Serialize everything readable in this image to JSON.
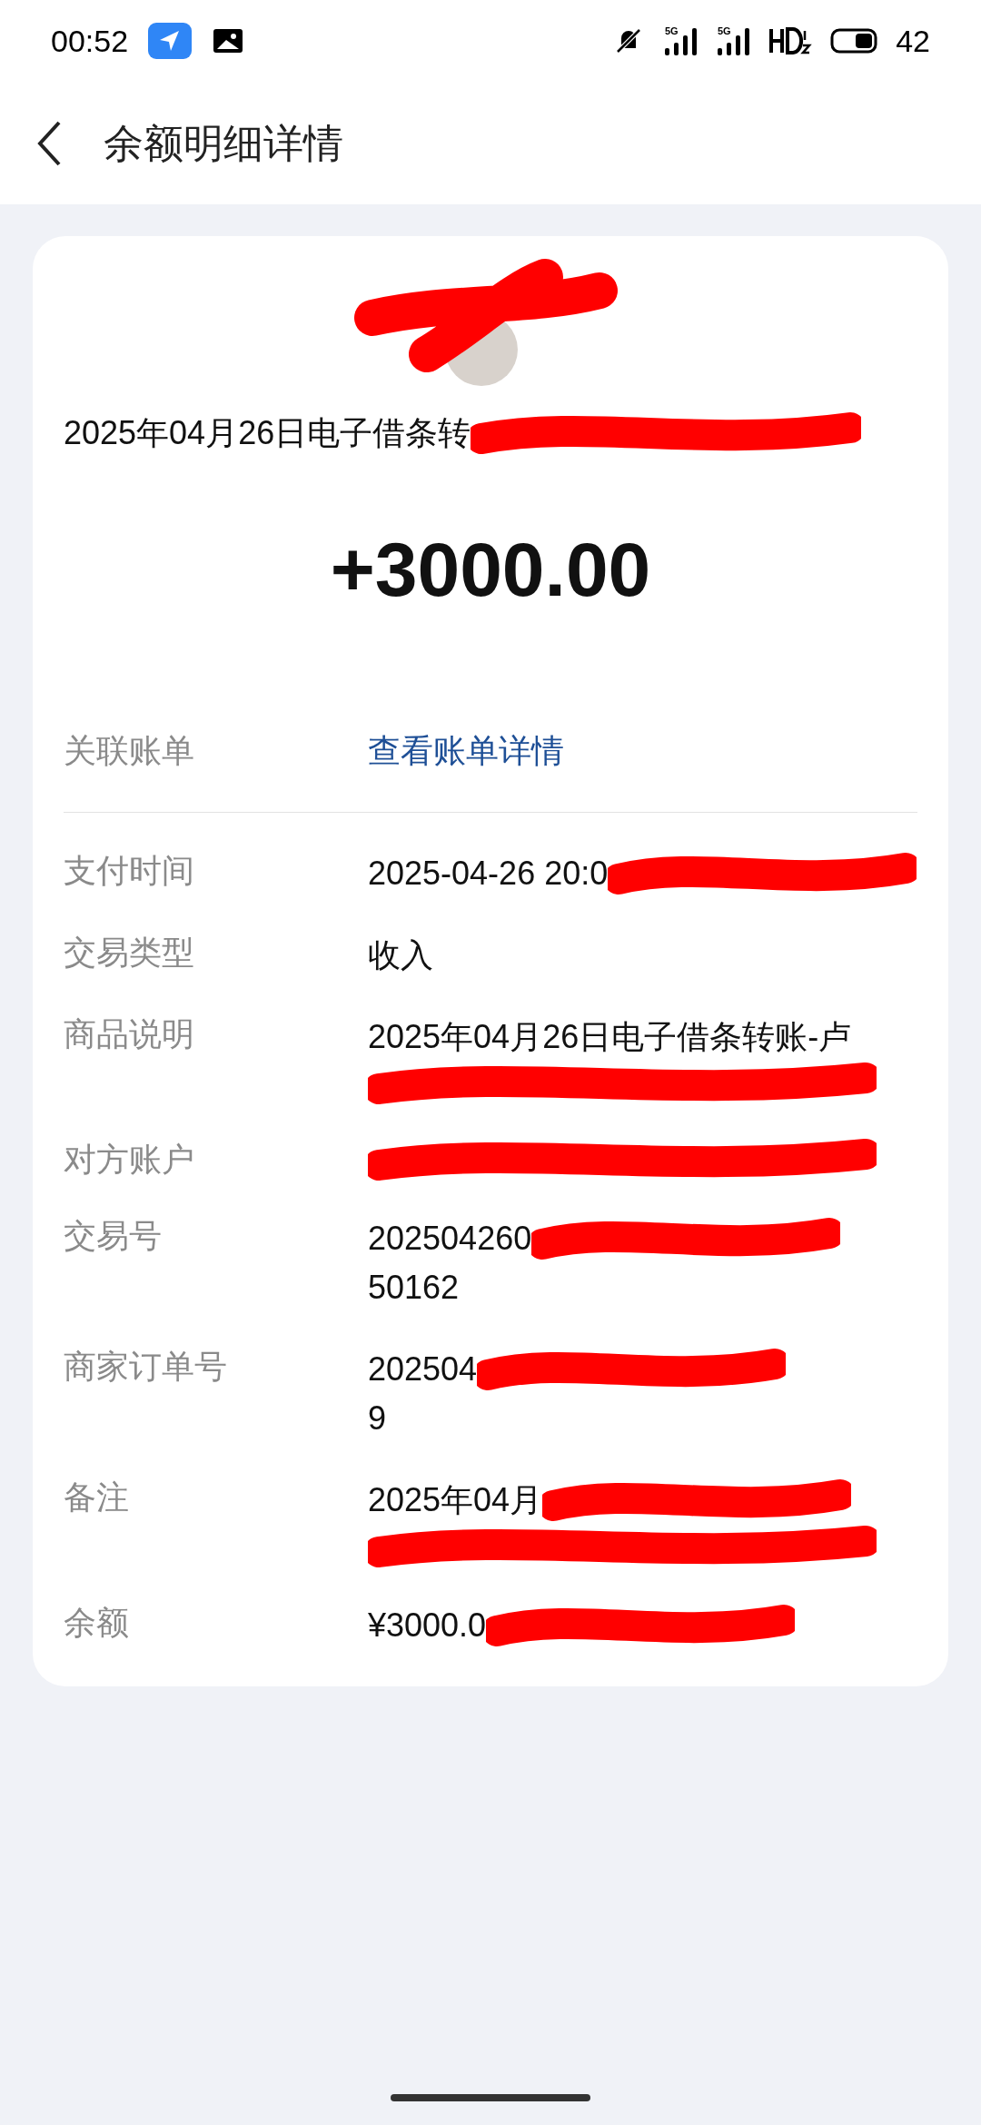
{
  "status_bar": {
    "time": "00:52",
    "networks": [
      "5G",
      "5G"
    ],
    "battery": "42"
  },
  "header": {
    "title": "余额明细详情"
  },
  "summary": {
    "description": "2025年04月26日电子借条转",
    "description_redacted": true,
    "amount": "+3000.00"
  },
  "linked_bill": {
    "label": "关联账单",
    "link": "查看账单详情"
  },
  "details": [
    {
      "label": "支付时间",
      "lines": [
        {
          "text": "2025-04-26 20:0",
          "redacted": true
        }
      ]
    },
    {
      "label": "交易类型",
      "lines": [
        {
          "text": "收入",
          "redacted": false
        }
      ]
    },
    {
      "label": "商品说明",
      "lines": [
        {
          "text": "2025年04月26日电子借条转账-卢",
          "redacted": false
        },
        {
          "redacted": true
        }
      ]
    },
    {
      "label": "对方账户",
      "lines": [
        {
          "redacted": true
        }
      ]
    },
    {
      "label": "交易号",
      "lines": [
        {
          "text": "202504260",
          "redacted": true
        },
        {
          "text": "50162",
          "redacted": false
        }
      ]
    },
    {
      "label": "商家订单号",
      "lines": [
        {
          "text": "202504",
          "redacted": true
        },
        {
          "text": "9",
          "redacted": false
        }
      ]
    },
    {
      "label": "备注",
      "lines": [
        {
          "text": "2025年04月",
          "redacted": true
        },
        {
          "redacted": true
        }
      ]
    },
    {
      "label": "余额",
      "lines": [
        {
          "text": "¥3000.0",
          "redacted": true
        }
      ]
    }
  ]
}
